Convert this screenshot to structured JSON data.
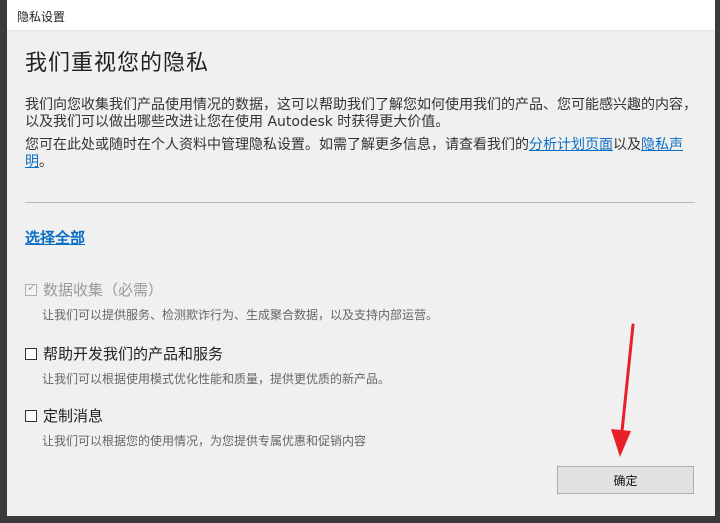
{
  "window": {
    "title": "隐私设置"
  },
  "main": {
    "heading": "我们重视您的隐私",
    "paragraph1": "我们向您收集我们产品使用情况的数据，这可以帮助我们了解您如何使用我们的产品、您可能感兴趣的内容，以及我们可以做出哪些改进让您在使用 Autodesk 时获得更大价值。",
    "paragraph2_prefix": "您可在此处或随时在个人资料中管理隐私设置。如需了解更多信息，请查看我们的",
    "paragraph2_link1": "分析计划页面",
    "paragraph2_middle": "以及",
    "paragraph2_link2": "隐私声明",
    "paragraph2_suffix": "。",
    "select_all": "选择全部"
  },
  "options": [
    {
      "label": "数据收集（必需）",
      "description": "让我们可以提供服务、检测欺诈行为、生成聚合数据，以及支持内部运营。",
      "checked": true,
      "disabled": true
    },
    {
      "label": "帮助开发我们的产品和服务",
      "description": "让我们可以根据使用模式优化性能和质量，提供更优质的新产品。",
      "checked": false,
      "disabled": false
    },
    {
      "label": "定制消息",
      "description": "让我们可以根据您的使用情况，为您提供专属优惠和促销内容",
      "checked": false,
      "disabled": false
    }
  ],
  "footer": {
    "ok_label": "确定"
  },
  "annotation": {
    "arrow_color": "#e8202a"
  },
  "colors": {
    "link": "#0b6fc5",
    "background": "#f0f0f0"
  }
}
